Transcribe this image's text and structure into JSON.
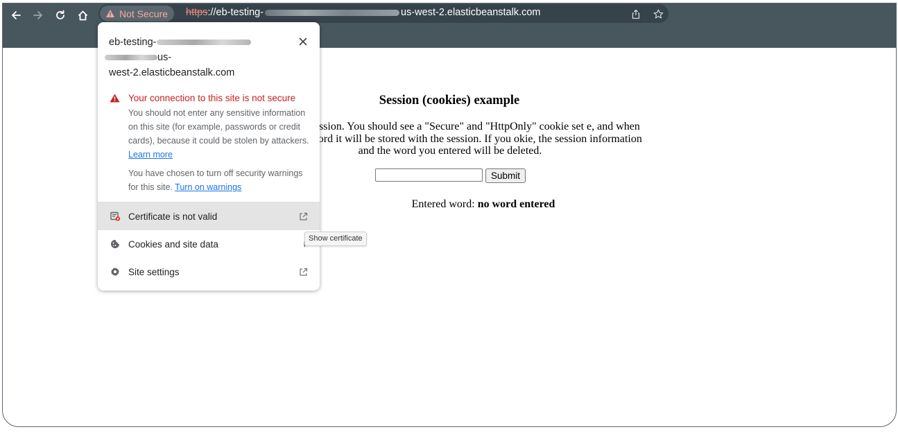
{
  "browser": {
    "security_chip_label": "Not Secure",
    "url_scheme": "https",
    "url_rest_start": "://eb-testing-",
    "url_rest_end": "us-west-2.elasticbeanstalk.com"
  },
  "page": {
    "heading": "Session (cookies) example",
    "description": "ample of a session. You should see a \"Secure\" and \"HttpOnly\" cookie set e, and when you enter a word it will be stored with the session. If you okie, the session information and the word you entered will be deleted.",
    "word_input_value": "",
    "submit_label": "Submit",
    "entered_label": "Entered word:",
    "entered_value": "no word entered"
  },
  "popup": {
    "host_line1": "eb-testing-",
    "host_line2": "us-",
    "host_line3": "west-2.elasticbeanstalk.com",
    "warning_title": "Your connection to this site is not secure",
    "warning_body": "You should not enter any sensitive information on this site (for example, passwords or credit cards), because it could be stolen by attackers.",
    "learn_more": "Learn more",
    "warnings_off_text": "You have chosen to turn off security warnings for this site.",
    "turn_on_warnings": "Turn on warnings",
    "menu": [
      {
        "label": "Certificate is not valid",
        "icon": "certificate-error-icon",
        "end_icon": "external-link-icon"
      },
      {
        "label": "Cookies and site data",
        "icon": "cookie-icon",
        "end_icon": "chevron-right-icon"
      },
      {
        "label": "Site settings",
        "icon": "gear-icon",
        "end_icon": "external-link-icon"
      }
    ]
  },
  "tooltip": {
    "text": "Show certificate"
  },
  "colors": {
    "toolbar": "#48565e",
    "warning_red": "#c5221f",
    "link_blue": "#1a73e8"
  }
}
